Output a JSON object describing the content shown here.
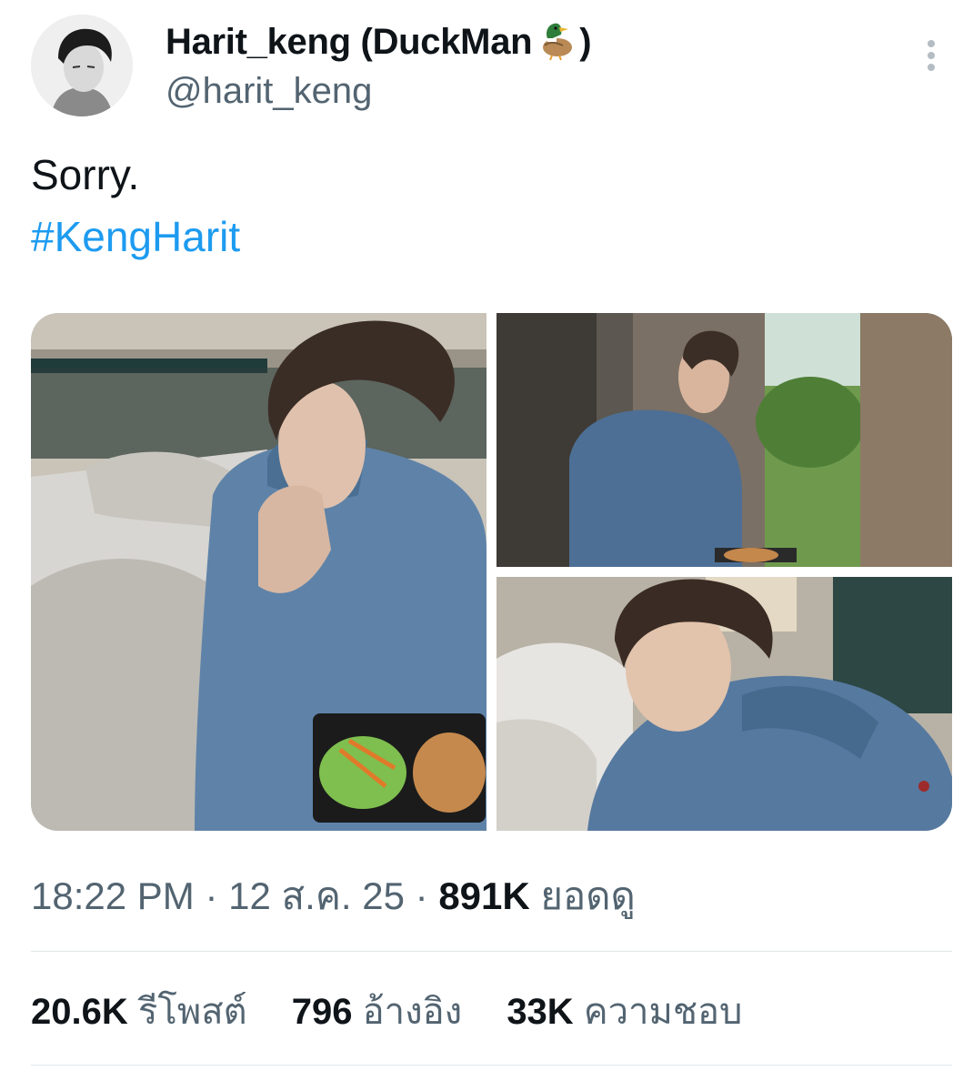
{
  "author": {
    "display_name": "Harit_keng (DuckMan",
    "display_name_suffix": ")",
    "name_emoji": "duck-icon",
    "handle": "@harit_keng",
    "avatar": "profile-photo"
  },
  "tweet": {
    "text": "Sorry.",
    "hashtag": "#KengHarit",
    "photos": [
      {
        "icon": "photo-man-on-bed-eating"
      },
      {
        "icon": "photo-man-by-window"
      },
      {
        "icon": "photo-man-selfie-on-bed"
      }
    ]
  },
  "meta": {
    "time": "18:22 PM",
    "separator": "·",
    "date": "12 ส.ค. 25",
    "views_count": "891K",
    "views_label": "ยอดดู"
  },
  "stats": {
    "reposts_count": "20.6K",
    "reposts_label": "รีโพสต์",
    "quotes_count": "796",
    "quotes_label": "อ้างอิง",
    "likes_count": "33K",
    "likes_label": "ความชอบ"
  },
  "colors": {
    "link": "#1d9bf0",
    "secondary_text": "#536471",
    "primary_text": "#0f1419",
    "divider": "#e1e6ea"
  }
}
